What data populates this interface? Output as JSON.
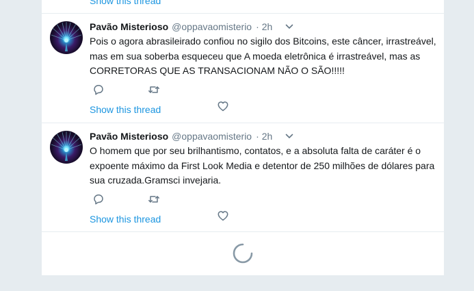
{
  "top": {
    "show_thread_label": "Show this thread"
  },
  "tweets": [
    {
      "author_name": "Pavão Misterioso",
      "author_handle": "@oppavaomisterio",
      "separator": "·",
      "time": "2h",
      "text": "Pois o agora abrasileirado confiou no sigilo dos Bitcoins, este câncer, irrastreável, mas em sua soberba esqueceu que A moeda eletrônica é irrastreável, mas as CORRETORAS QUE AS TRANSACIONAM NÃO O SÃO!!!!!",
      "show_thread_label": "Show this thread"
    },
    {
      "author_name": "Pavão Misterioso",
      "author_handle": "@oppavaomisterio",
      "separator": "·",
      "time": "2h",
      "text": "O homem que por seu brilhantismo, contatos, e a absoluta falta de caráter é o expoente máximo da First Look Media e detentor de 250 milhões de dólares para sua cruzada.Gramsci invejaria.",
      "show_thread_label": "Show this thread"
    }
  ],
  "icons": {
    "reply": "reply-icon",
    "retweet": "retweet-icon",
    "like": "heart-icon",
    "caret": "chevron-down-icon",
    "loading": "loading-spinner-icon"
  },
  "colors": {
    "background": "#e6ecf0",
    "card": "#ffffff",
    "link": "#1b95e0",
    "text": "#14171a",
    "muted": "#657786",
    "icon": "#657786",
    "spinner": "#8899a6"
  }
}
